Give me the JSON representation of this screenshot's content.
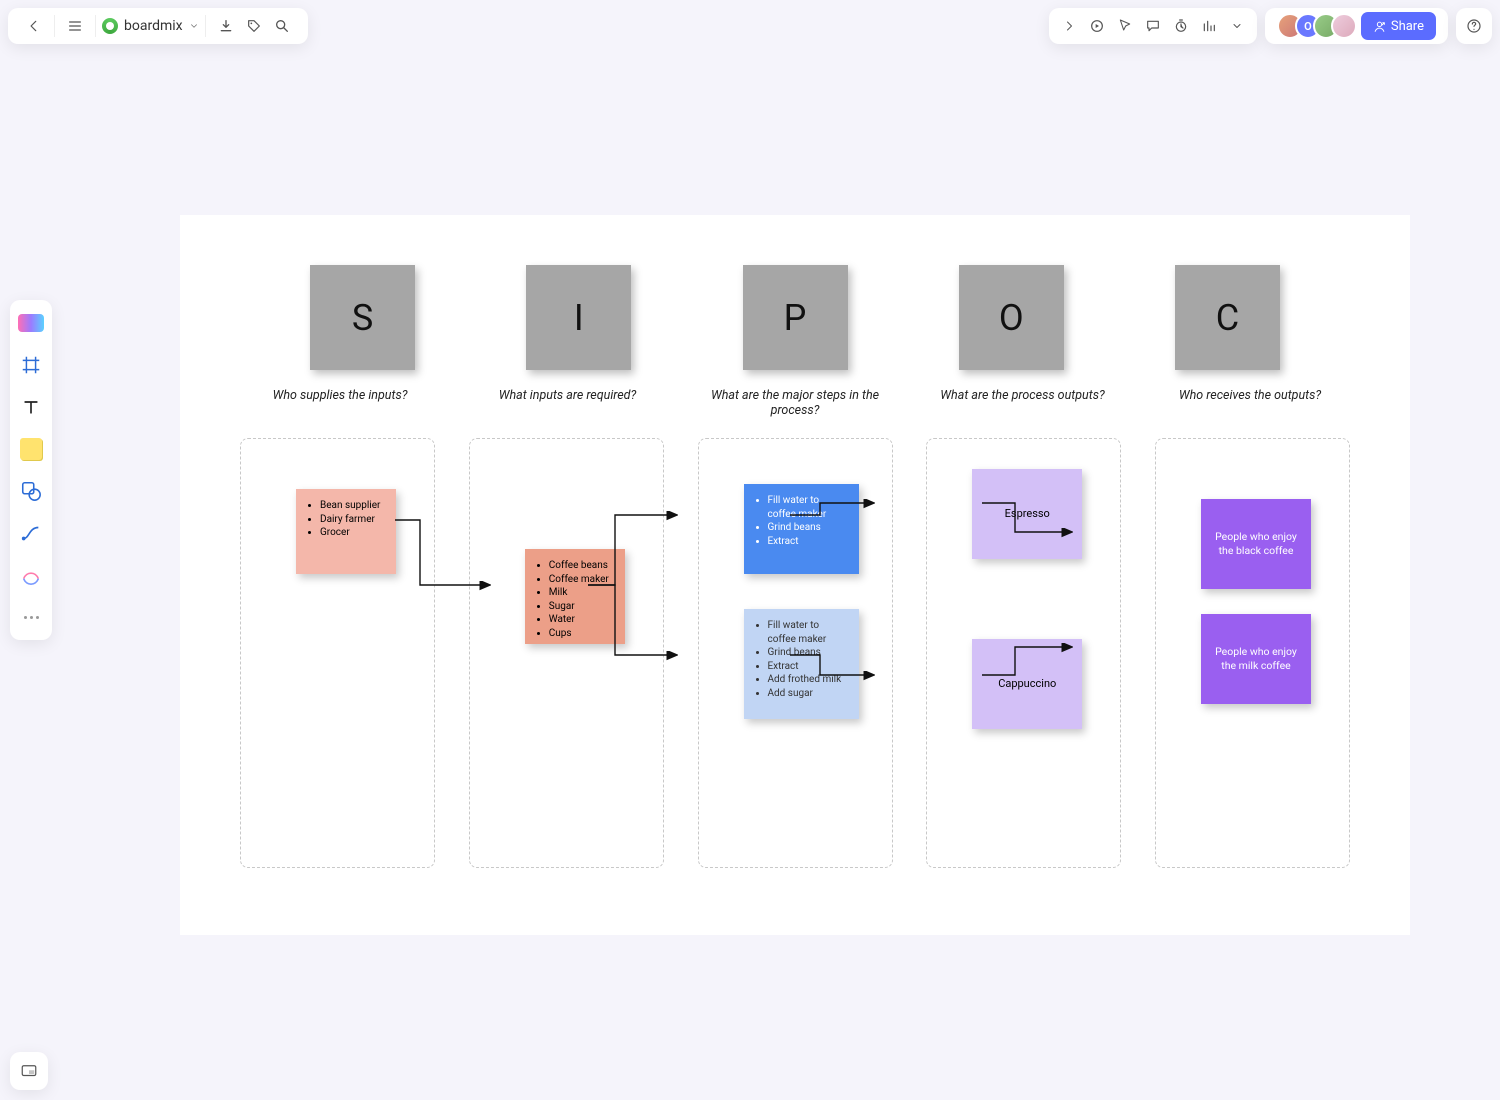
{
  "header": {
    "brand": "boardmix",
    "share_label": "Share"
  },
  "avatars": {
    "a2_initial": "O"
  },
  "sipoc": {
    "headers": [
      "S",
      "I",
      "P",
      "O",
      "C"
    ],
    "subheads": [
      "Who supplies the inputs?",
      "What inputs are required?",
      "What are the major steps in the process?",
      "What are the process outputs?",
      "Who receives the outputs?"
    ],
    "suppliers": {
      "items": [
        "Bean supplier",
        "Dairy farmer",
        "Grocer"
      ]
    },
    "inputs": {
      "items": [
        "Coffee beans",
        "Coffee maker",
        "Milk",
        "Sugar",
        "Water",
        "Cups"
      ]
    },
    "process1": {
      "items": [
        "Fill water to coffee maker",
        "Grind beans",
        "Extract"
      ]
    },
    "process2": {
      "items": [
        "Fill water to coffee maker",
        "Grind beans",
        "Extract",
        "Add frothed milk",
        "Add sugar"
      ]
    },
    "output1": "Espresso",
    "output2": "Cappuccino",
    "customer1": "People who enjoy the black coffee",
    "customer2": "People who enjoy the milk coffee"
  }
}
